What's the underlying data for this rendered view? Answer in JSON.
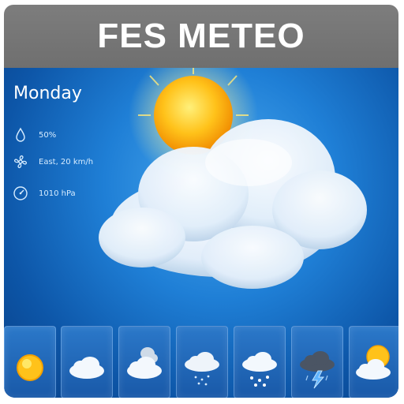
{
  "app": {
    "title": "FES METEO"
  },
  "current": {
    "day": "Monday",
    "humidity": "50%",
    "wind": "East, 20 km/h",
    "pressure": "1010 hPa",
    "condition_icon": "sun-behind-cloud"
  },
  "forecast": [
    {
      "icon": "sun"
    },
    {
      "icon": "cloud"
    },
    {
      "icon": "cloudy"
    },
    {
      "icon": "cloud-light-rain"
    },
    {
      "icon": "cloud-snow"
    },
    {
      "icon": "thunderstorm"
    },
    {
      "icon": "sun-behind-cloud"
    }
  ],
  "colors": {
    "title_bar": "#757575",
    "sky": "#1f7fd6",
    "sun": "#ffc21a"
  }
}
